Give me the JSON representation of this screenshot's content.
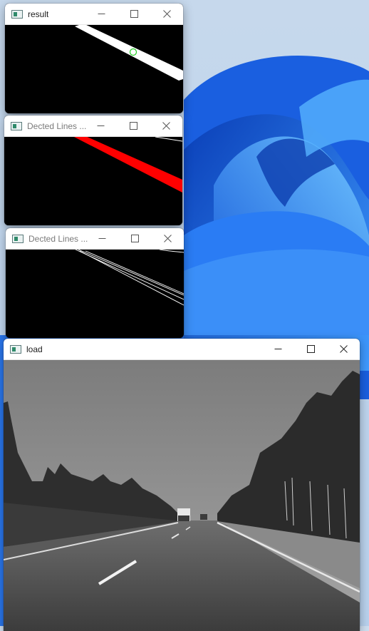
{
  "windows": {
    "result": {
      "title": "result"
    },
    "lines1": {
      "title": "Dected Lines ..."
    },
    "lines2": {
      "title": "Dected Lines ..."
    },
    "load": {
      "title": "load"
    }
  },
  "controls": {
    "minimize_icon": "minimize-icon",
    "maximize_icon": "maximize-icon",
    "close_icon": "close-icon"
  },
  "colors": {
    "titlebar": "#ffffff",
    "canvas": "#000000",
    "red_line": "#ff0000",
    "green_circle": "#22cc22",
    "wallpaper_blue": "#1f6fe0"
  }
}
